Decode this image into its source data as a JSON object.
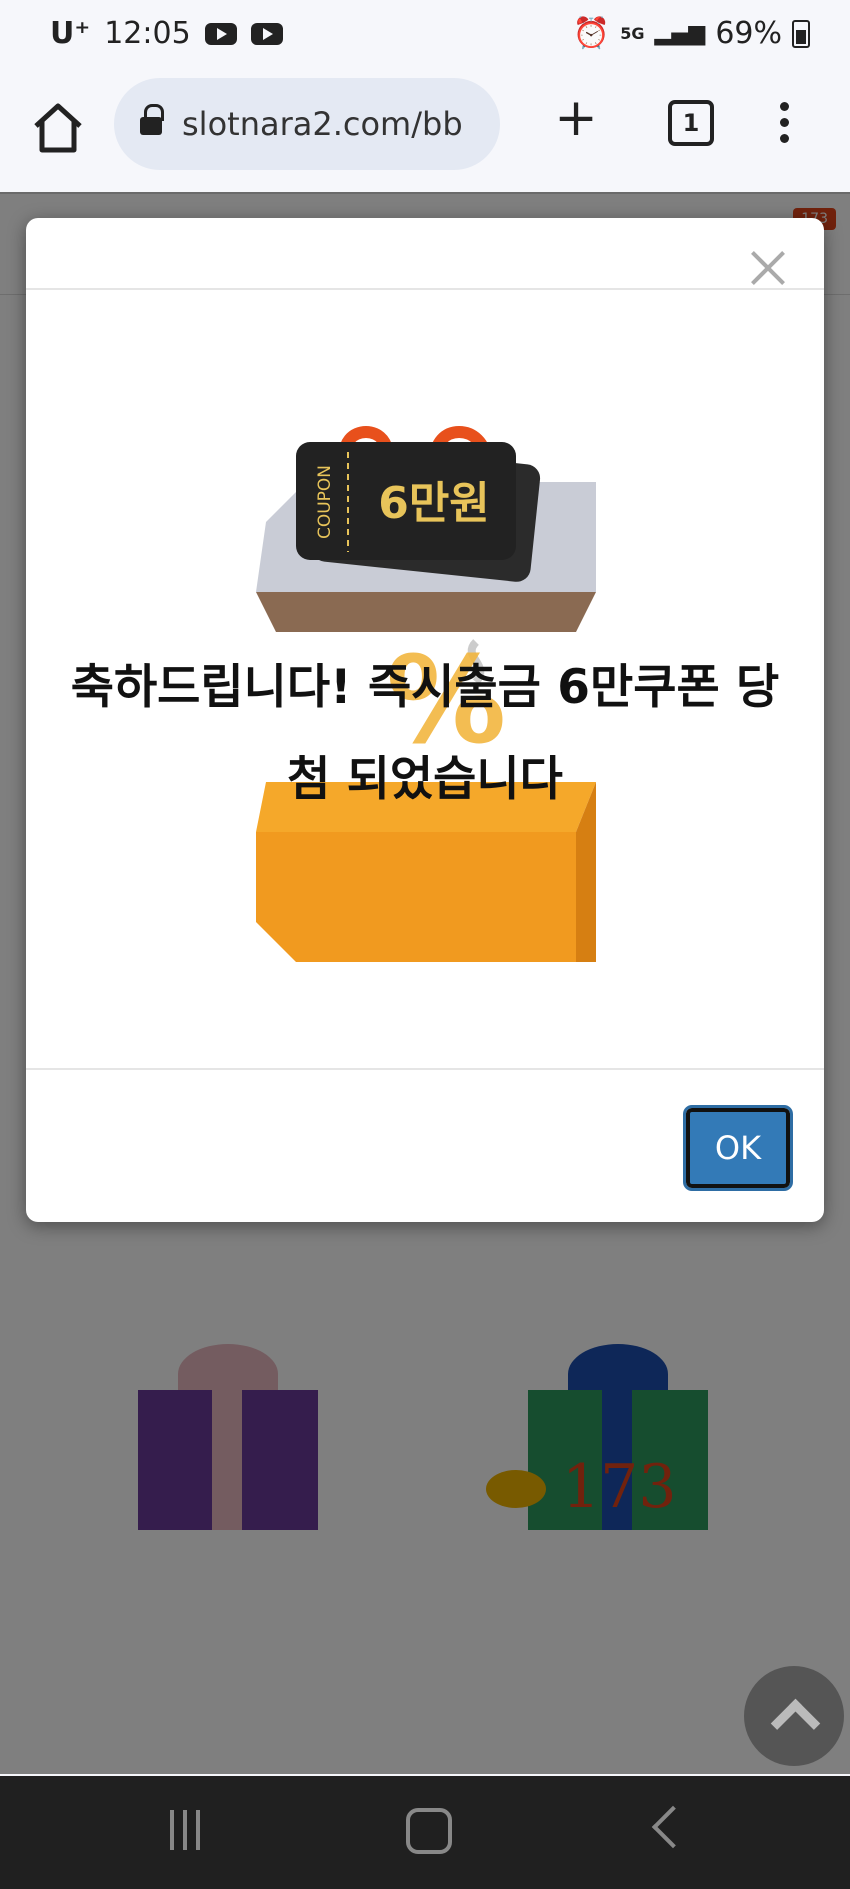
{
  "status_bar": {
    "carrier": "U⁺",
    "time": "12:05",
    "network": "5G",
    "battery": "69%"
  },
  "browser": {
    "url": "slotnara2.com/bb",
    "tab_count": "1"
  },
  "page": {
    "notification_badge": "173",
    "comment_count": "173"
  },
  "modal": {
    "coupon_label": "COUPON",
    "coupon_amount": "6만원",
    "message_line1": "축하드립니다! 즉시출금 6만쿠폰 당",
    "message_line2": "첨 되었습니다",
    "ok_label": "OK"
  },
  "colors": {
    "ok_button": "#337ab7",
    "coupon_gold": "#e8c45a",
    "box_orange": "#f19a1f",
    "badge": "#e2451b"
  }
}
